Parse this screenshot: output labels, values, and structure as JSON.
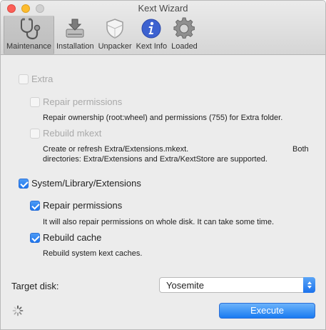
{
  "window": {
    "title": "Kext Wizard"
  },
  "toolbar": {
    "tabs": [
      {
        "label": "Maintenance",
        "icon": "stethoscope-icon"
      },
      {
        "label": "Installation",
        "icon": "install-drive-icon"
      },
      {
        "label": "Unpacker",
        "icon": "shield-icon"
      },
      {
        "label": "Kext Info",
        "icon": "info-icon"
      },
      {
        "label": "Loaded",
        "icon": "gear-icon"
      }
    ]
  },
  "maintenance": {
    "extra": {
      "label": "Extra",
      "repair": {
        "label": "Repair permissions",
        "description": "Repair ownership (root:wheel) and permissions (755) for Extra folder."
      },
      "rebuild": {
        "label": "Rebuild mkext",
        "description_line1": "Create or refresh Extra/Extensions.mkext.",
        "description_line1b": "Both",
        "description_line2": "directories: Extra/Extensions and Extra/KextStore are supported."
      }
    },
    "system": {
      "label": "System/Library/Extensions",
      "repair": {
        "label": "Repair permissions",
        "description": "It will also repair permissions on whole disk. It can take some time."
      },
      "rebuild": {
        "label": "Rebuild cache",
        "description": "Rebuild system kext caches."
      }
    }
  },
  "footer": {
    "target_label": "Target disk:",
    "target_value": "Yosemite",
    "execute_label": "Execute"
  },
  "colors": {
    "accent": "#1d75ee"
  }
}
